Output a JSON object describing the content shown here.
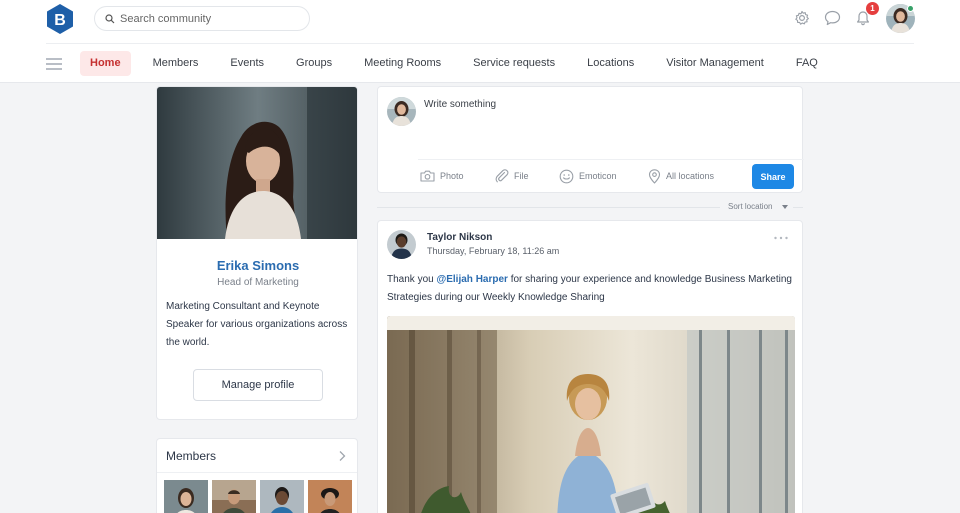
{
  "app": {
    "logo_letter": "B",
    "brand_color": "#1e5fa8",
    "accent_color": "#1e88e5"
  },
  "search": {
    "placeholder": "Search community",
    "icon": "search-icon"
  },
  "topbar": {
    "icons": [
      "gear-icon",
      "chat-bubble-icon",
      "bell-icon"
    ],
    "notification_count": "1"
  },
  "nav": {
    "items": [
      {
        "label": "Home",
        "active": true
      },
      {
        "label": "Members"
      },
      {
        "label": "Events"
      },
      {
        "label": "Groups"
      },
      {
        "label": "Meeting Rooms"
      },
      {
        "label": "Service requests"
      },
      {
        "label": "Locations"
      },
      {
        "label": "Visitor Management"
      },
      {
        "label": "FAQ"
      }
    ]
  },
  "profile": {
    "name": "Erika Simons",
    "role": "Head of Marketing",
    "bio": "Marketing Consultant and Keynote Speaker for various organizations across the world.",
    "manage_label": "Manage profile"
  },
  "members": {
    "title": "Members"
  },
  "composer": {
    "placeholder": "Write something",
    "tools": [
      {
        "label": "Photo",
        "icon": "camera-icon"
      },
      {
        "label": "File",
        "icon": "paperclip-icon"
      },
      {
        "label": "Emoticon",
        "icon": "smiley-icon"
      },
      {
        "label": "All locations",
        "icon": "location-pin-icon"
      }
    ],
    "share_label": "Share"
  },
  "sort": {
    "label": "Sort location"
  },
  "post": {
    "author": "Taylor Nikson",
    "date": "Thursday, February 18, 11:26 am",
    "text_before": "Thank you ",
    "mention": "@Elijah Harper",
    "text_after": "  for sharing your experience and knowledge Business Marketing Strategies during our Weekly Knowledge Sharing"
  }
}
